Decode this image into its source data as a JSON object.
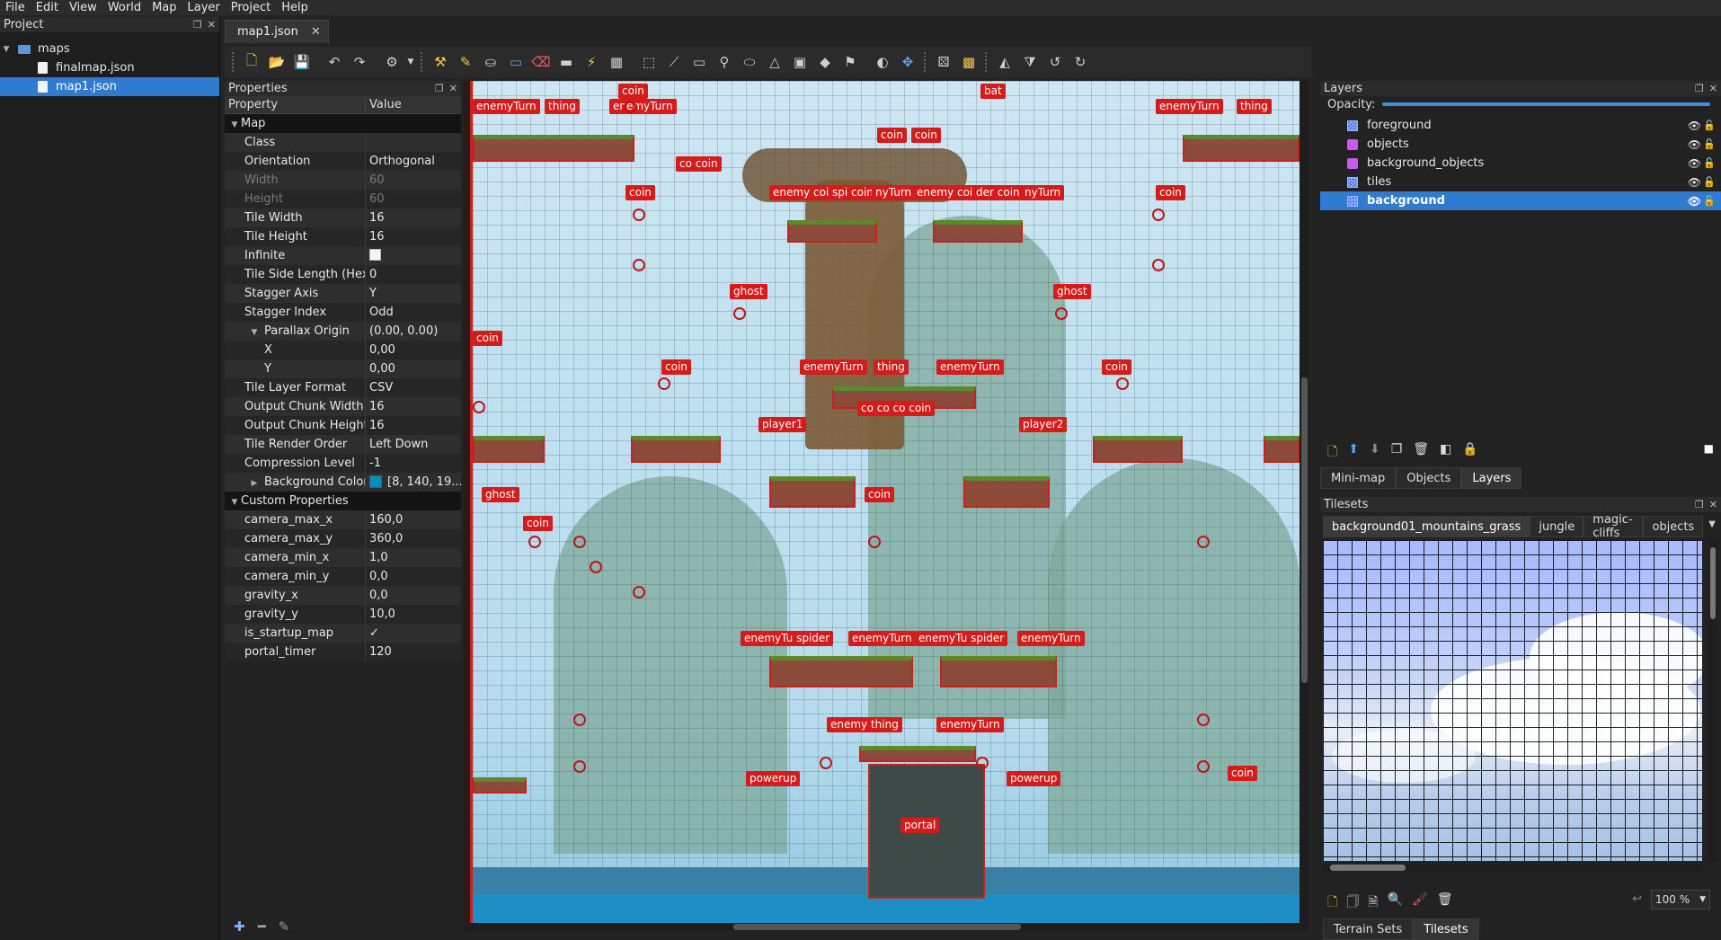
{
  "menubar": [
    "File",
    "Edit",
    "View",
    "World",
    "Map",
    "Layer",
    "Project",
    "Help"
  ],
  "project": {
    "title": "Project",
    "tree": [
      {
        "label": "maps",
        "type": "folder",
        "level": 0,
        "selected": false
      },
      {
        "label": "finalmap.json",
        "type": "file",
        "level": 1,
        "selected": false
      },
      {
        "label": "map1.json",
        "type": "file",
        "level": 1,
        "selected": true
      }
    ]
  },
  "document_tab": "map1.json",
  "properties": {
    "title": "Properties",
    "col_property": "Property",
    "col_value": "Value",
    "rows": [
      {
        "name": "Map",
        "value": "",
        "group": true,
        "indent": 0
      },
      {
        "name": "Class",
        "value": "",
        "indent": 1
      },
      {
        "name": "Orientation",
        "value": "Orthogonal",
        "indent": 1
      },
      {
        "name": "Width",
        "value": "60",
        "indent": 1,
        "disabled": true
      },
      {
        "name": "Height",
        "value": "60",
        "indent": 1,
        "disabled": true
      },
      {
        "name": "Tile Width",
        "value": "16",
        "indent": 1
      },
      {
        "name": "Tile Height",
        "value": "16",
        "indent": 1
      },
      {
        "name": "Infinite",
        "value": "",
        "indent": 1,
        "checkbox": true
      },
      {
        "name": "Tile Side Length (Hex)",
        "value": "0",
        "indent": 1
      },
      {
        "name": "Stagger Axis",
        "value": "Y",
        "indent": 1
      },
      {
        "name": "Stagger Index",
        "value": "Odd",
        "indent": 1
      },
      {
        "name": "Parallax Origin",
        "value": "(0.00, 0.00)",
        "indent": 1,
        "expander": "open"
      },
      {
        "name": "X",
        "value": "0,00",
        "indent": 2
      },
      {
        "name": "Y",
        "value": "0,00",
        "indent": 2
      },
      {
        "name": "Tile Layer Format",
        "value": "CSV",
        "indent": 1
      },
      {
        "name": "Output Chunk Width",
        "value": "16",
        "indent": 1
      },
      {
        "name": "Output Chunk Height",
        "value": "16",
        "indent": 1
      },
      {
        "name": "Tile Render Order",
        "value": "Left Down",
        "indent": 1
      },
      {
        "name": "Compression Level",
        "value": "-1",
        "indent": 1
      },
      {
        "name": "Background Color",
        "value": "[8, 140, 19...",
        "indent": 1,
        "expander": "closed",
        "color": "#088cbe"
      },
      {
        "name": "Custom Properties",
        "value": "",
        "group": true,
        "indent": 0
      },
      {
        "name": "camera_max_x",
        "value": "160,0",
        "indent": 1
      },
      {
        "name": "camera_max_y",
        "value": "360,0",
        "indent": 1
      },
      {
        "name": "camera_min_x",
        "value": "1,0",
        "indent": 1
      },
      {
        "name": "camera_min_y",
        "value": "0,0",
        "indent": 1
      },
      {
        "name": "gravity_x",
        "value": "0,0",
        "indent": 1
      },
      {
        "name": "gravity_y",
        "value": "10,0",
        "indent": 1
      },
      {
        "name": "is_startup_map",
        "value": "✓",
        "indent": 1
      },
      {
        "name": "portal_timer",
        "value": "120",
        "indent": 1
      }
    ]
  },
  "map_objects": {
    "labels": [
      "enemyTurn",
      "thing",
      "coin",
      "enemyTurn",
      "bat",
      "enemyTurn",
      "thing",
      "coin",
      "coin",
      "co coin",
      "enemy coin",
      "spi coin",
      "nyTurn",
      "enemy coin",
      "der coin",
      "nyTurn",
      "coin",
      "coin",
      "ghost",
      "ghost",
      "coin",
      "coin",
      "coin",
      "enemyTurn",
      "thing",
      "enemyTurn",
      "player1",
      "player2",
      "co co co coin",
      "coin",
      "ghost",
      "coin",
      "enemyTu spider",
      "enemyTurn",
      "enemyTu spider",
      "enemyTurn",
      "enemy thing",
      "enemyTurn",
      "powerup",
      "powerup",
      "portal",
      "coin"
    ]
  },
  "layers": {
    "title": "Layers",
    "opacity_label": "Opacity:",
    "items": [
      {
        "label": "foreground",
        "kind": "tile",
        "selected": false
      },
      {
        "label": "objects",
        "kind": "obj",
        "selected": false
      },
      {
        "label": "background_objects",
        "kind": "obj",
        "selected": false
      },
      {
        "label": "tiles",
        "kind": "tile",
        "selected": false
      },
      {
        "label": "background",
        "kind": "tile",
        "selected": true
      }
    ],
    "dock_tabs": [
      "Mini-map",
      "Objects",
      "Layers"
    ]
  },
  "tilesets": {
    "title": "Tilesets",
    "tabs": [
      "background01_mountains_grass",
      "jungle",
      "magic-cliffs",
      "objects"
    ],
    "zoom": "100 %",
    "bottom_tabs": [
      "Terrain Sets",
      "Tilesets"
    ]
  }
}
